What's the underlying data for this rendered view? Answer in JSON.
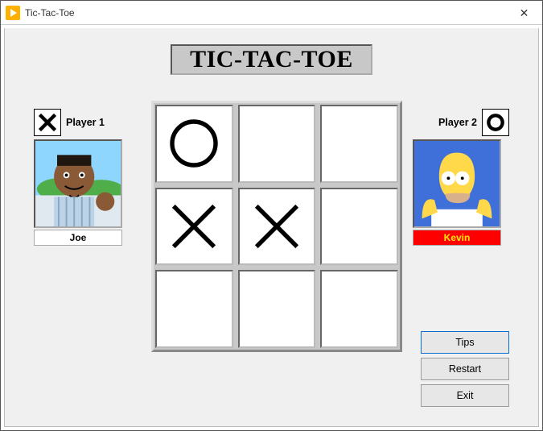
{
  "window": {
    "title": "Tic-Tac-Toe"
  },
  "heading": "TIC-TAC-TOE",
  "player1": {
    "label": "Player 1",
    "name": "Joe",
    "symbol": "X",
    "highlighted": false
  },
  "player2": {
    "label": "Player 2",
    "name": "Kevin",
    "symbol": "O",
    "highlighted": true
  },
  "board": {
    "cells": [
      "O",
      "",
      "",
      "X",
      "X",
      "",
      "",
      "",
      ""
    ]
  },
  "buttons": {
    "tips": "Tips",
    "restart": "Restart",
    "exit": "Exit"
  },
  "icons": {
    "close": "✕"
  }
}
